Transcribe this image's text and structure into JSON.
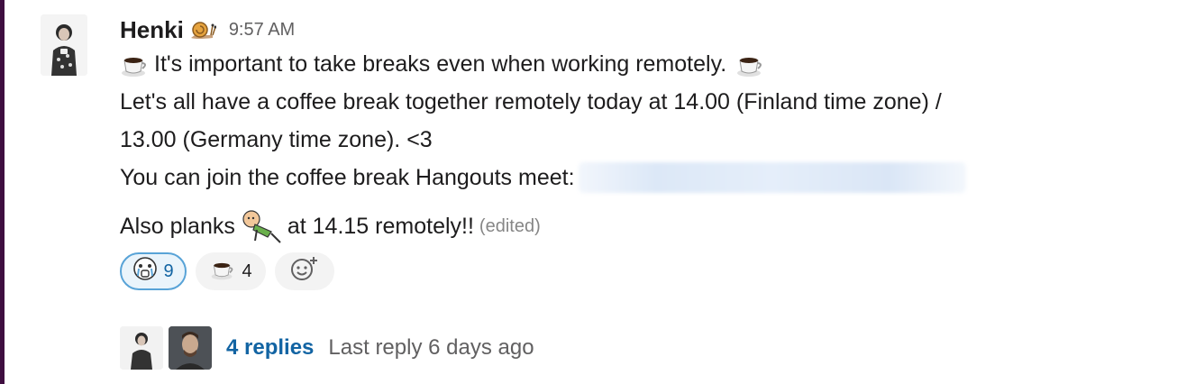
{
  "message": {
    "author": "Henki",
    "status_emoji": "snail-icon",
    "time": "9:57 AM",
    "line1": "It's important to take breaks even when working remotely.",
    "line2": "Let's all have a coffee break together remotely today at 14.00  (Finland time zone) /",
    "line3": "13.00 (Germany time zone). <3",
    "line4": "You can join the coffee break Hangouts meet:",
    "line5_before": "Also planks",
    "line5_after": "at 14.15 remotely!!",
    "edited": "(edited)"
  },
  "reactions": [
    {
      "icon": "crying-face-icon",
      "count": "9",
      "active": true
    },
    {
      "icon": "coffee-icon",
      "count": "4",
      "active": false
    }
  ],
  "thread": {
    "replies": "4 replies",
    "last_reply": "Last reply 6 days ago"
  },
  "colors": {
    "link": "#1264a3",
    "active_reaction_border": "#58a3d7",
    "sidebar_edge": "#3f0e40"
  }
}
